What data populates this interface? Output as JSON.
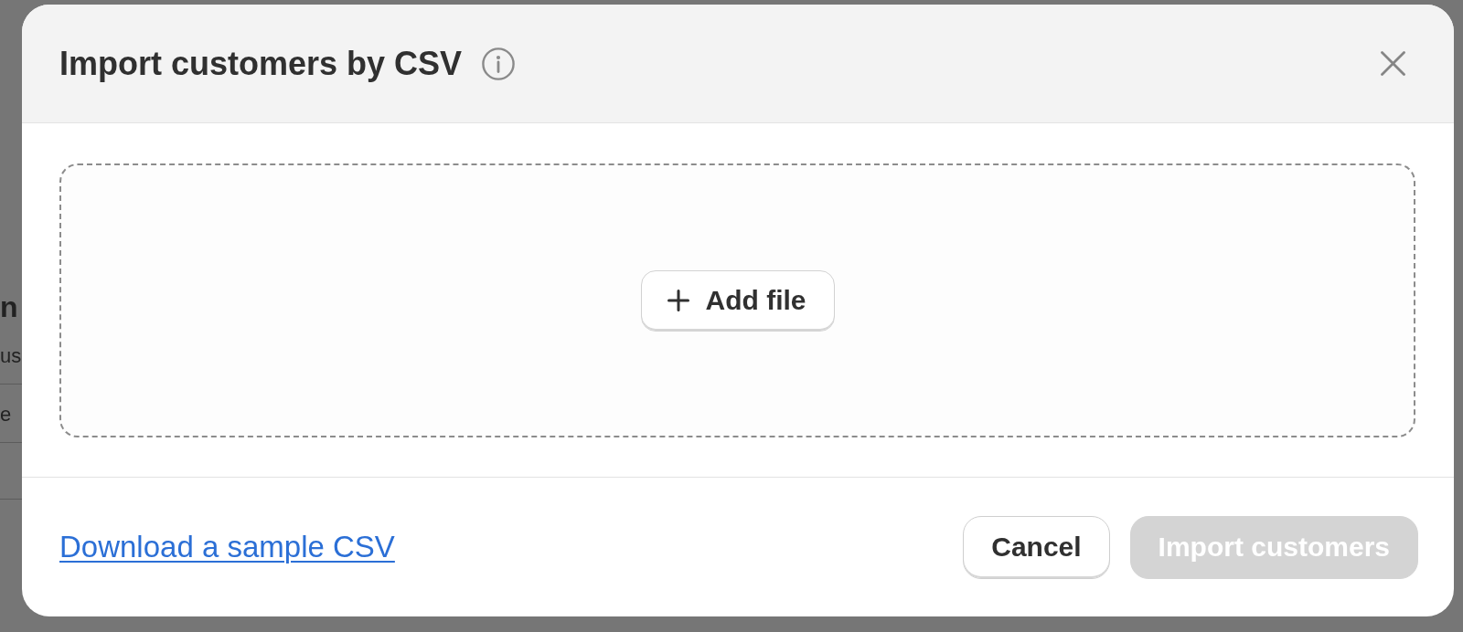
{
  "backdrop": {
    "texts": [
      {
        "text": "n",
        "kind": "heading"
      },
      {
        "text": "us",
        "kind": "text"
      },
      {
        "text": "e",
        "kind": "text"
      }
    ]
  },
  "dialog": {
    "title": "Import customers by CSV",
    "dropzone": {
      "button": "Add file"
    },
    "footer": {
      "link": "Download a sample CSV",
      "buttons": [
        {
          "label": "Cancel",
          "kind": "secondary",
          "disabled": false
        },
        {
          "label": "Import customers",
          "kind": "primary",
          "disabled": true
        }
      ]
    }
  }
}
